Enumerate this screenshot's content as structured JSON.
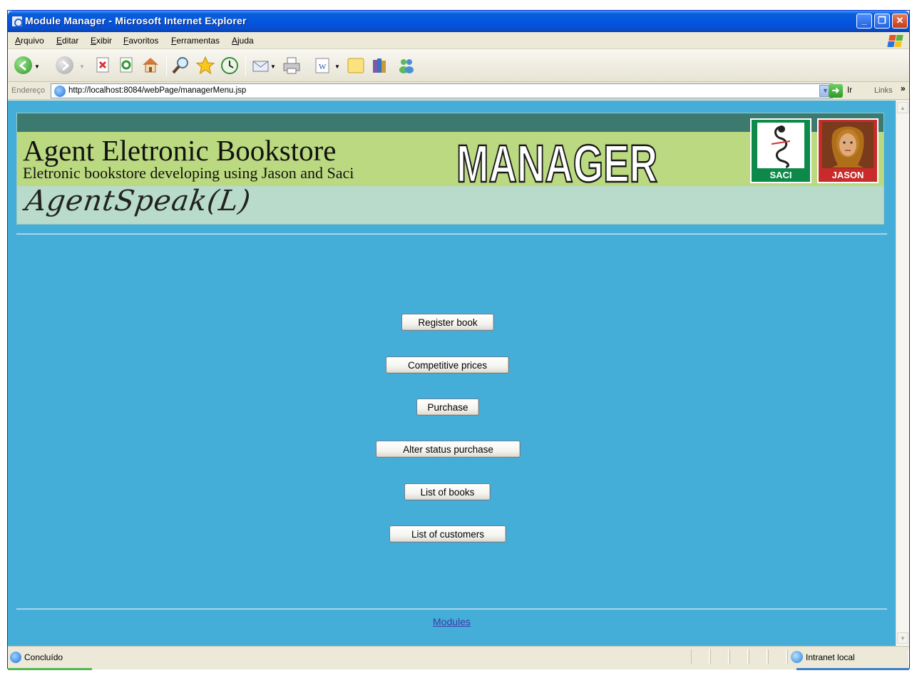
{
  "window": {
    "title": "Module Manager - Microsoft Internet Explorer",
    "buttons": {
      "minimize": "_",
      "maximize": "❐",
      "close": "✕"
    }
  },
  "menubar": {
    "items": [
      "Arquivo",
      "Editar",
      "Exibir",
      "Favoritos",
      "Ferramentas",
      "Ajuda"
    ]
  },
  "toolbar": {
    "icons": [
      "back-icon",
      "forward-icon",
      "stop-icon",
      "refresh-icon",
      "home-icon",
      "search-icon",
      "favorites-icon",
      "history-icon",
      "mail-icon",
      "print-icon",
      "edit-icon",
      "discuss-icon",
      "research-icon",
      "messenger-icon"
    ]
  },
  "addressbar": {
    "label": "Endereço",
    "url": "http://localhost:8084/webPage/managerMenu.jsp",
    "go_label": "Ir",
    "links_label": "Links",
    "links_chevron": "»"
  },
  "banner": {
    "title": "Agent Eletronic Bookstore",
    "subtitle": "Eletronic bookstore developing using Jason and Saci",
    "heading": "MANAGER",
    "script_text": "AgentSpeak(L)",
    "logo_left_label": "SACI",
    "logo_right_label": "JASON"
  },
  "menu_buttons": [
    "Register book",
    "Competitive prices",
    "Purchase",
    "Alter status purchase",
    "List of books",
    "List of customers"
  ],
  "footer": {
    "link": "Modules"
  },
  "statusbar": {
    "status_text": "Concluído",
    "zone_text": "Intranet local"
  },
  "colors": {
    "page_background": "#45aed8",
    "banner_dark_band": "#3c7a70",
    "banner_green": "#bbd980",
    "banner_mint": "#b8dbcb",
    "link": "#3a3aa6"
  }
}
